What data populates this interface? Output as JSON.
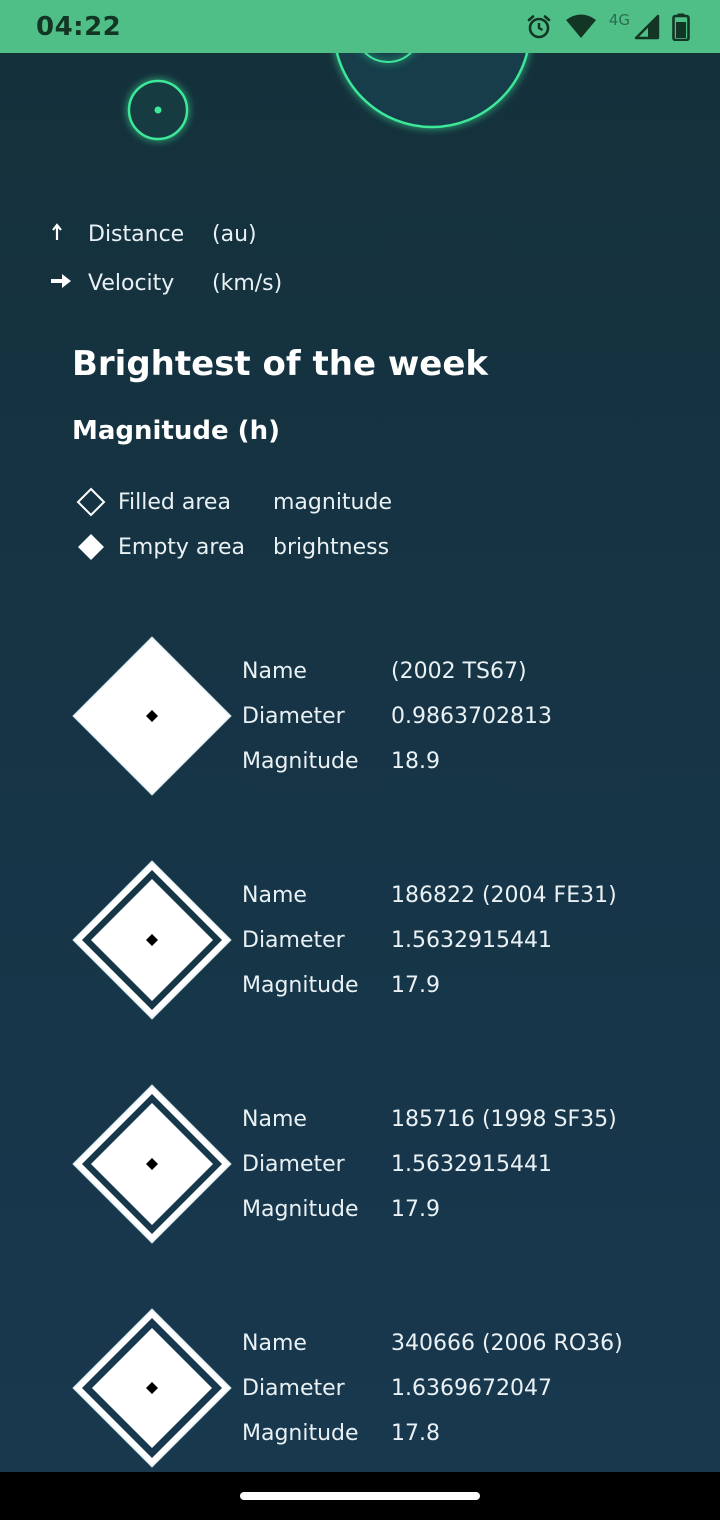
{
  "status": {
    "time": "04:22",
    "network": "4G"
  },
  "legend": {
    "distance": {
      "label": "Distance",
      "unit": "(au)",
      "icon": "arrow-up-icon"
    },
    "velocity": {
      "label": "Velocity",
      "unit": "(km/s)",
      "icon": "arrow-right-icon"
    }
  },
  "section": {
    "title": "Brightest of the week",
    "subtitle": "Magnitude (h)"
  },
  "key": {
    "filled": {
      "label": "Filled area",
      "meaning": "magnitude"
    },
    "empty": {
      "label": "Empty area",
      "meaning": "brightness"
    }
  },
  "labels": {
    "name": "Name",
    "diameter": "Diameter",
    "magnitude": "Magnitude"
  },
  "asteroids": [
    {
      "name": "(2002 TS67)",
      "diameter": "0.9863702813",
      "magnitude": "18.9"
    },
    {
      "name": "186822 (2004 FE31)",
      "diameter": "1.5632915441",
      "magnitude": "17.9"
    },
    {
      "name": "185716 (1998 SF35)",
      "diameter": "1.5632915441",
      "magnitude": "17.9"
    },
    {
      "name": "340666 (2006 RO36)",
      "diameter": "1.6369672047",
      "magnitude": "17.8"
    }
  ],
  "colors": {
    "status_bar": "#4fbf87",
    "orbit_glow": "#3de89a",
    "background_top": "#14303a",
    "background_bottom": "#18384f"
  }
}
